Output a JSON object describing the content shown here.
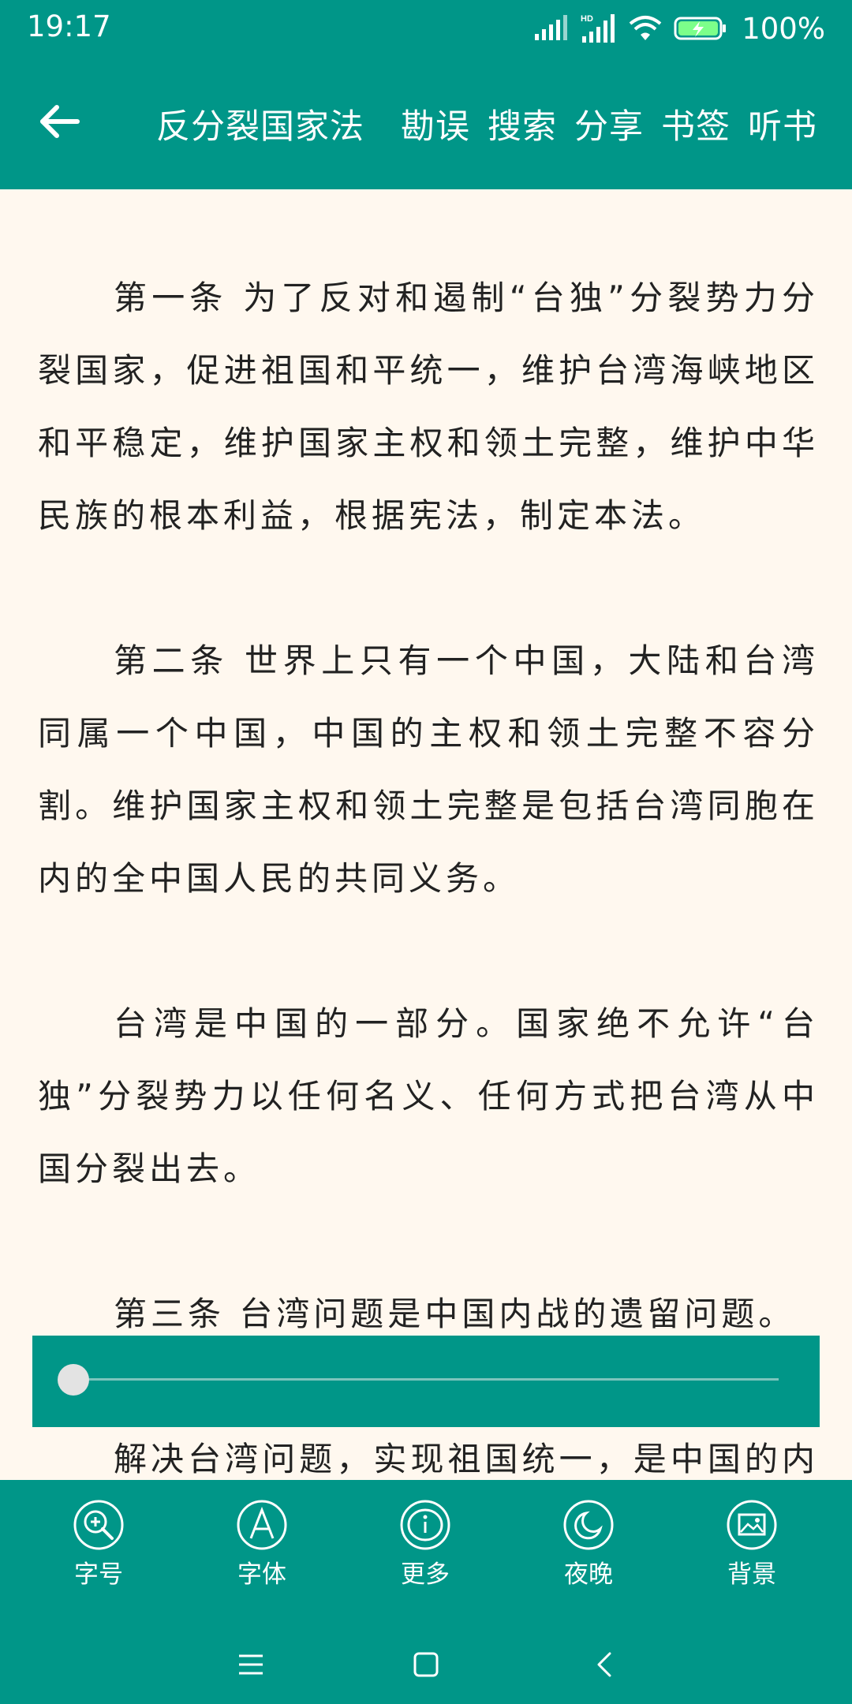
{
  "status_bar": {
    "time": "19:17",
    "battery": "100%",
    "icons": [
      "signal-icon",
      "hd-signal-icon",
      "wifi-icon",
      "battery-charging-icon"
    ]
  },
  "toolbar": {
    "title": "反分裂国家法",
    "actions": [
      "勘误",
      "搜索",
      "分享",
      "书签",
      "听书"
    ]
  },
  "content": {
    "paragraphs": [
      "第一条 为了反对和遏制“台独”分裂势力分裂国家，促进祖国和平统一，维护台湾海峡地区和平稳定，维护国家主权和领土完整，维护中华民族的根本利益，根据宪法，制定本法。",
      "第二条 世界上只有一个中国，大陆和台湾同属一个中国，中国的主权和领土完整不容分割。维护国家主权和领土完整是包括台湾同胞在内的全中国人民的共同义务。",
      "台湾是中国的一部分。国家绝不允许“台独”分裂势力以任何名义、任何方式把台湾从中国分裂出去。",
      "第三条 台湾问题是中国内战的遗留问题。",
      "解决台湾问题，实现祖国统一，是中国的内部事务。"
    ]
  },
  "progress": {
    "value": 0.0
  },
  "bottom_menu": [
    {
      "label": "字号",
      "icon": "font-size-icon"
    },
    {
      "label": "字体",
      "icon": "font-icon"
    },
    {
      "label": "更多",
      "icon": "info-icon"
    },
    {
      "label": "夜晚",
      "icon": "night-mode-icon"
    },
    {
      "label": "背景",
      "icon": "background-image-icon"
    }
  ],
  "nav": [
    "menu-icon",
    "home-icon",
    "back-icon"
  ],
  "colors": {
    "primary": "#009688",
    "page_background": "#FFF8EF",
    "text": "#222222"
  }
}
